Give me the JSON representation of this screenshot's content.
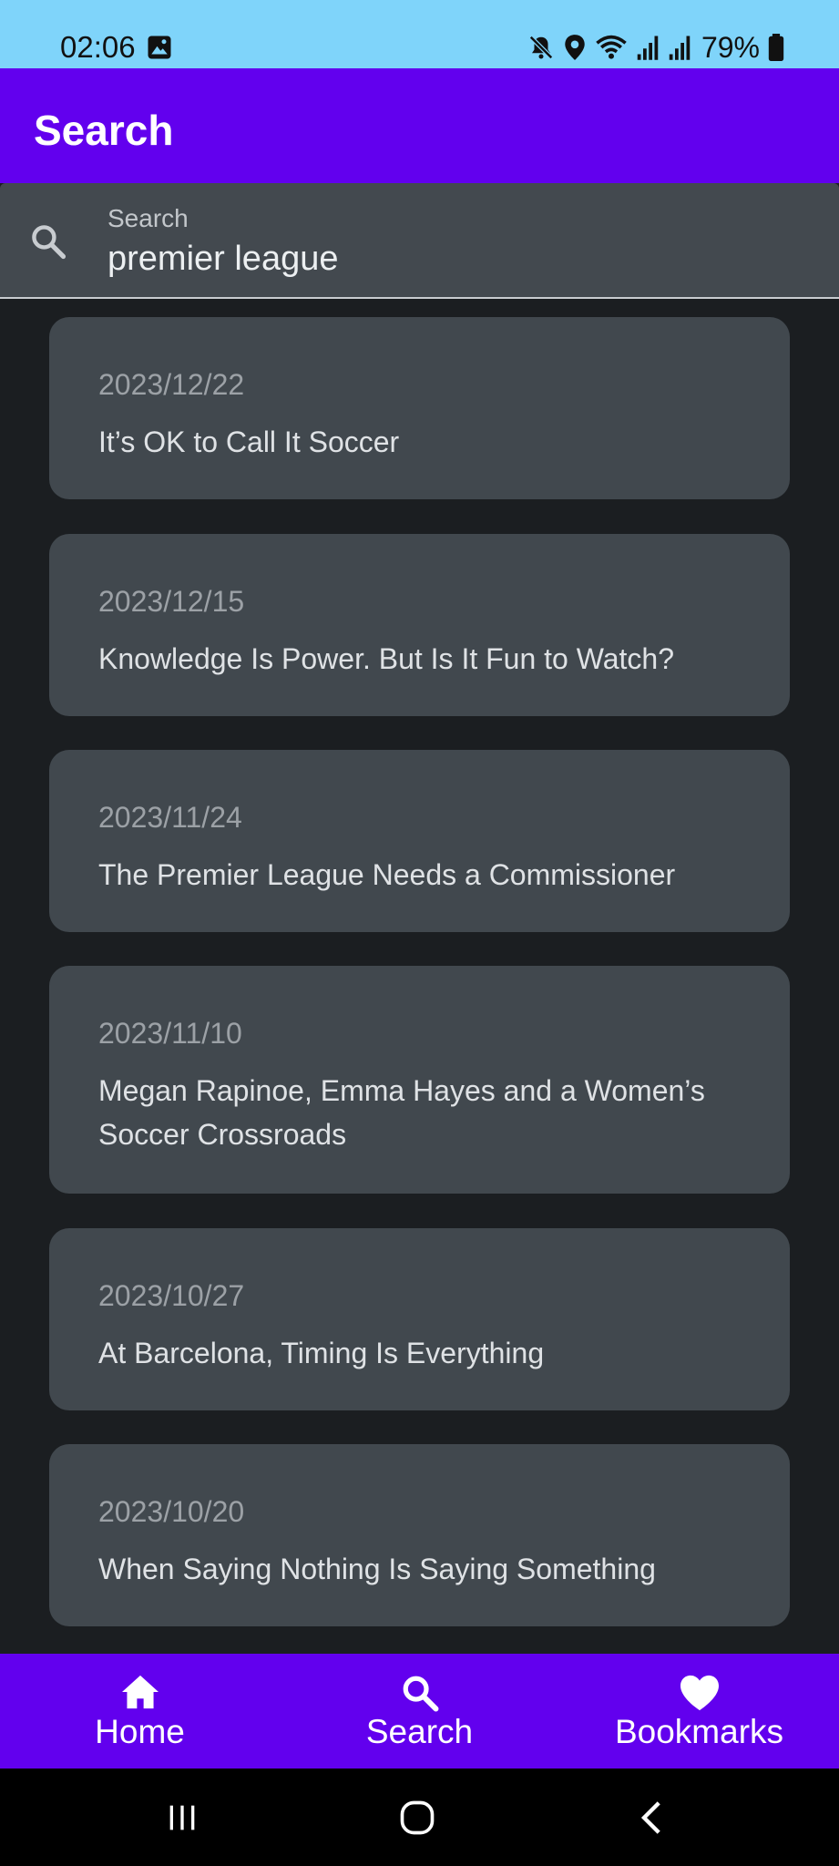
{
  "status_bar": {
    "time": "02:06",
    "battery": "79%",
    "icons": [
      "image-icon",
      "mute-icon",
      "location-icon",
      "wifi-icon",
      "signal-icon",
      "signal-icon",
      "battery-icon"
    ]
  },
  "app_bar": {
    "title": "Search"
  },
  "search": {
    "label": "Search",
    "value": "premier league"
  },
  "results": [
    {
      "date": "2023/12/22",
      "title": "It’s OK to Call It Soccer"
    },
    {
      "date": "2023/12/15",
      "title": "Knowledge Is Power. But Is It Fun to Watch?"
    },
    {
      "date": "2023/11/24",
      "title": "The Premier League Needs a Commissioner"
    },
    {
      "date": "2023/11/10",
      "title": "Megan Rapinoe, Emma Hayes and a Women’s Soccer Crossroads"
    },
    {
      "date": "2023/10/27",
      "title": "At Barcelona, Timing Is Everything"
    },
    {
      "date": "2023/10/20",
      "title": "When Saying Nothing Is Saying Something"
    }
  ],
  "bottom_nav": [
    {
      "label": "Home",
      "icon": "home-icon"
    },
    {
      "label": "Search",
      "icon": "search-icon"
    },
    {
      "label": "Bookmarks",
      "icon": "heart-icon"
    }
  ],
  "colors": {
    "status_bar": "#7fd4fa",
    "primary": "#6200ee",
    "background": "#1b1e21",
    "card": "#41484e"
  }
}
